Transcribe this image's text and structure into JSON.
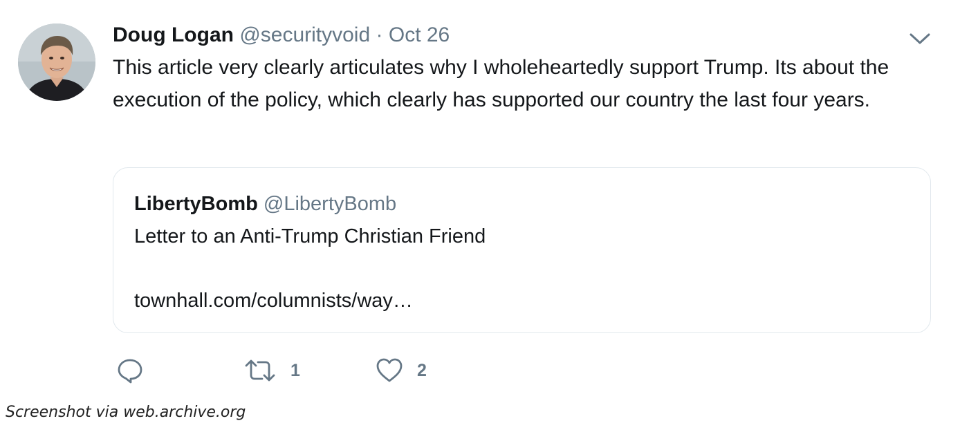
{
  "tweet": {
    "author_name": "Doug Logan",
    "author_handle": "@securityvoid",
    "separator": "·",
    "timestamp": "Oct 26",
    "text": "This article very clearly articulates why I wholeheartedly support Trump. Its about the execution of the policy, which clearly has supported our country the last four years.",
    "avatar_icon": "person-photo-avatar",
    "menu_icon": "chevron-down-icon"
  },
  "quoted_tweet": {
    "author_name": "LibertyBomb",
    "author_handle": "@LibertyBomb",
    "text": "Letter to an Anti-Trump Christian Friend",
    "link": "townhall.com/columnists/way…"
  },
  "actions": {
    "reply": {
      "icon": "reply-icon",
      "count": ""
    },
    "retweet": {
      "icon": "retweet-icon",
      "count": "1"
    },
    "like": {
      "icon": "heart-icon",
      "count": "2"
    }
  },
  "caption": "Screenshot via web.archive.org",
  "colors": {
    "text_primary": "#14171a",
    "text_secondary": "#657786",
    "card_border": "#e1e8ed",
    "background": "#ffffff"
  }
}
